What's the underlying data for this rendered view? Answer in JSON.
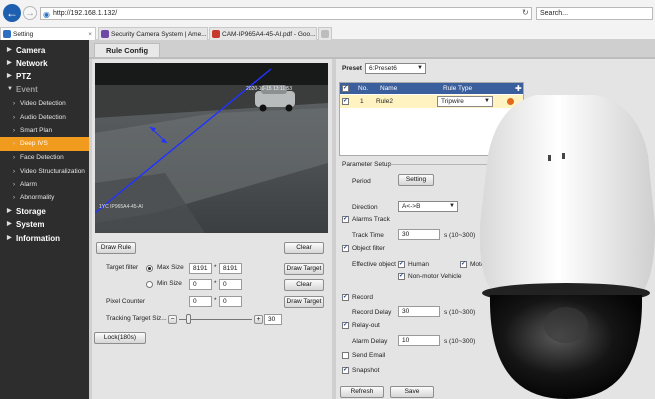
{
  "browser": {
    "url": "http://192.168.1.132/",
    "search_placeholder": "Search...",
    "tabs": [
      {
        "label": "Setting",
        "color": "#2e6fc2"
      },
      {
        "label": "Security Camera System | Ame...",
        "color": "#6e49a8"
      },
      {
        "label": "CAM-IP965A4-45-AI.pdf - Goo...",
        "color": "#c8382c"
      },
      {
        "label": "",
        "color": "#9a9a9a"
      }
    ]
  },
  "sidebar": {
    "items": [
      {
        "label": "Camera",
        "level": "top"
      },
      {
        "label": "Network",
        "level": "top"
      },
      {
        "label": "PTZ",
        "level": "top"
      },
      {
        "label": "Event",
        "level": "top-muted"
      },
      {
        "label": "Video Detection",
        "level": "sub"
      },
      {
        "label": "Audio Detection",
        "level": "sub"
      },
      {
        "label": "Smart Plan",
        "level": "sub"
      },
      {
        "label": "Deep IVS",
        "level": "sub-active"
      },
      {
        "label": "Face Detection",
        "level": "sub"
      },
      {
        "label": "Video Structuralization",
        "level": "sub"
      },
      {
        "label": "Alarm",
        "level": "sub"
      },
      {
        "label": "Abnormality",
        "level": "sub"
      },
      {
        "label": "Storage",
        "level": "top"
      },
      {
        "label": "System",
        "level": "top"
      },
      {
        "label": "Information",
        "level": "top"
      }
    ]
  },
  "page": {
    "tab_label": "Rule Config"
  },
  "video": {
    "timestamp": "2020-10-15 13:11:53",
    "camera_label": "1YC IP965A4-45-AI"
  },
  "left_panel": {
    "draw_rule": "Draw Rule",
    "clear": "Clear",
    "target_filter_label": "Target filter",
    "max_size_label": "Max Size",
    "max_w": "8191",
    "max_h": "8191",
    "min_size_label": "Min Size",
    "min_w": "0",
    "min_h": "0",
    "times": "*",
    "draw_target": "Draw Target",
    "clear2": "Clear",
    "pixel_counter_label": "Pixel Counter",
    "pixel_w": "0",
    "pixel_h": "0",
    "draw_target2": "Draw Target",
    "tracking_label": "Tracking Target Siz...",
    "tracking_value": "30",
    "tracking_fraction": 0.13,
    "minus": "−",
    "plus": "+",
    "lock": "Lock(180s)"
  },
  "right_panel": {
    "preset_label": "Preset",
    "preset_value": "6:Preset6",
    "table_headers": {
      "no": "No.",
      "name": "Name",
      "rule_type": "Rule Type"
    },
    "rule_row": {
      "no": "1",
      "name": "Rule2",
      "rule_type": "Tripwire"
    },
    "param_setup": "Parameter Setup",
    "period_label": "Period",
    "setting_btn": "Setting",
    "direction_label": "Direction",
    "direction_value": "A<->B",
    "alarm_track_label": "Alarms Track",
    "track_time_label": "Track Time",
    "track_time_value": "30",
    "track_time_unit": "s (10~300)",
    "object_filter_label": "Object filter",
    "effective_object_label": "Effective object",
    "human_label": "Human",
    "motor_label": "Moto",
    "nonmotor_label": "Non-motor Vehicle",
    "record_label": "Record",
    "record_delay_label": "Record Delay",
    "record_delay_value": "30",
    "record_delay_unit": "s (10~300)",
    "relay_label": "Relay-out",
    "alarm_delay_label": "Alarm Delay",
    "alarm_delay_value": "10",
    "alarm_delay_unit": "s (10~300)",
    "send_email_label": "Send Email",
    "snapshot_label": "Snapshot",
    "refresh": "Refresh",
    "save": "Save"
  }
}
